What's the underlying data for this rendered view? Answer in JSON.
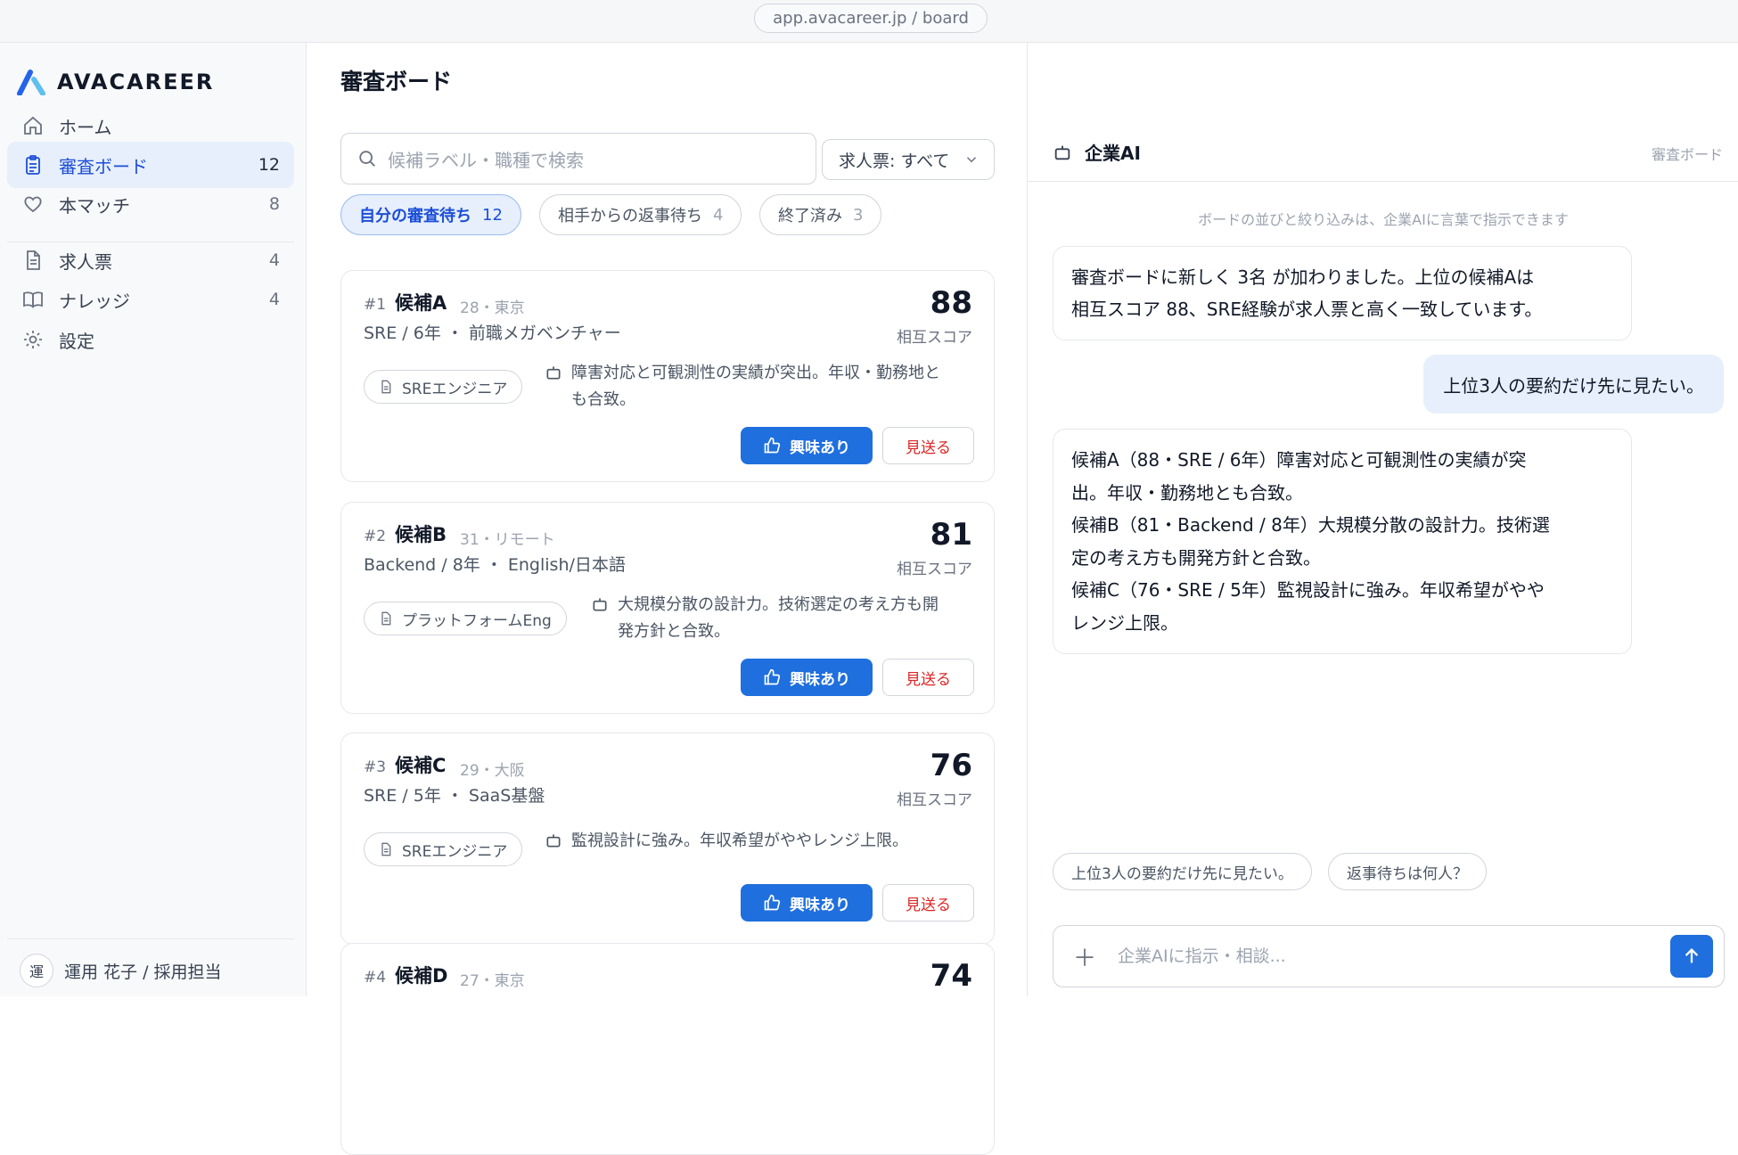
{
  "browser": {
    "url": "app.avacareer.jp / board"
  },
  "brand": {
    "name": "AVACAREER"
  },
  "sidebar": {
    "items": [
      {
        "label": "ホーム",
        "icon": "home-icon"
      },
      {
        "label": "審査ボード",
        "count": "12",
        "icon": "clipboard-icon",
        "active": true
      },
      {
        "label": "本マッチ",
        "count": "8",
        "icon": "heart-icon"
      },
      {
        "label": "求人票",
        "count": "4",
        "icon": "document-icon"
      },
      {
        "label": "ナレッジ",
        "count": "4",
        "icon": "book-icon"
      },
      {
        "label": "設定",
        "icon": "gear-icon"
      }
    ],
    "user": {
      "avatar": "運",
      "label": "運用 花子 / 採用担当"
    }
  },
  "main": {
    "title": "審査ボード",
    "search_placeholder": "候補ラベル・職種で検索",
    "filter": {
      "label": "求人票: すべて"
    },
    "tabs": [
      {
        "label": "自分の審査待ち",
        "count": "12",
        "active": true
      },
      {
        "label": "相手からの返事待ち",
        "count": "4"
      },
      {
        "label": "終了済み",
        "count": "3"
      }
    ],
    "candidates": [
      {
        "rank": "#1",
        "name": "候補A",
        "meta": "28・東京",
        "role": "SRE / 6年 ・ 前職メガベンチャー",
        "score": "88",
        "score_label": "相互スコア",
        "tag": "SREエンジニア",
        "summary_line1": "障害対応と可観測性の実績が突出。年収・勤務地と",
        "summary_line2": "も合致。",
        "like": "興味あり",
        "pass": "見送る"
      },
      {
        "rank": "#2",
        "name": "候補B",
        "meta": "31・リモート",
        "role": "Backend / 8年 ・ English/日本語",
        "score": "81",
        "score_label": "相互スコア",
        "tag": "プラットフォームEng",
        "summary_line1": "大規模分散の設計力。技術選定の考え方も開",
        "summary_line2": "発方針と合致。",
        "like": "興味あり",
        "pass": "見送る"
      },
      {
        "rank": "#3",
        "name": "候補C",
        "meta": "29・大阪",
        "role": "SRE / 5年 ・ SaaS基盤",
        "score": "76",
        "score_label": "相互スコア",
        "tag": "SREエンジニア",
        "summary_line1": "監視設計に強み。年収希望がややレンジ上限。",
        "summary_line2": "",
        "like": "興味あり",
        "pass": "見送る"
      },
      {
        "rank": "#4",
        "name": "候補D",
        "meta": "27・東京",
        "score": "74"
      }
    ]
  },
  "ai": {
    "title": "企業AI",
    "breadcrumb": "審査ボード",
    "hint": "ボードの並びと絞り込みは、企業AIに言葉で指示できます",
    "msg1_line1": "審査ボードに新しく 3名 が加わりました。上位の候補Aは",
    "msg1_line2": "相互スコア 88、SRE経験が求人票と高く一致しています。",
    "user_msg": "上位3人の要約だけ先に見たい。",
    "msg2_lines": [
      "候補A（88・SRE / 6年）障害対応と可観測性の実績が突",
      "出。年収・勤務地とも合致。",
      "候補B（81・Backend / 8年）大規模分散の設計力。技術選",
      "定の考え方も開発方針と合致。",
      "候補C（76・SRE / 5年）監視設計に強み。年収希望がやや",
      "レンジ上限。"
    ],
    "suggestions": [
      "上位3人の要約だけ先に見たい。",
      "返事待ちは何人？"
    ],
    "input_placeholder": "企業AIに指示・相談..."
  },
  "colors": {
    "accent": "#1f6fde",
    "active_bg": "#e6effb",
    "danger": "#dc2626",
    "brand_light": "#5ec0ee"
  }
}
